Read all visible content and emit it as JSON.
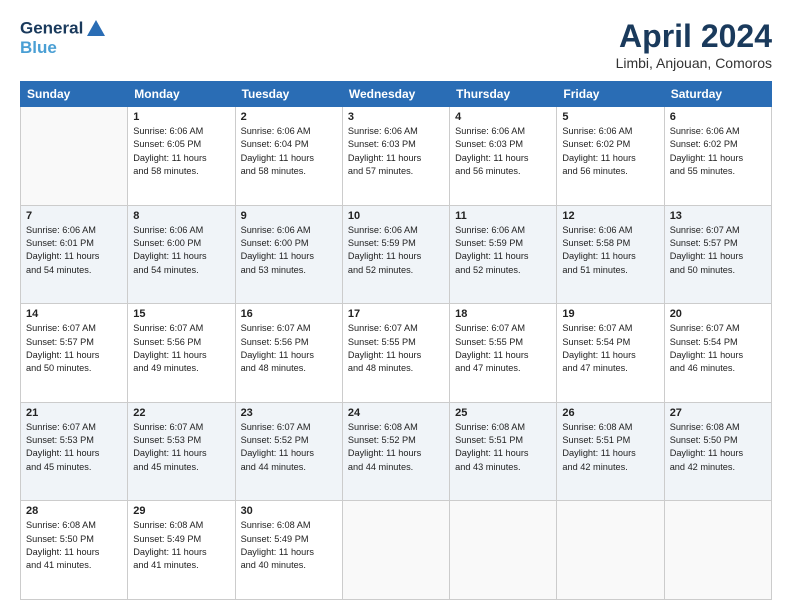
{
  "header": {
    "logo_line1": "General",
    "logo_line2": "Blue",
    "month_title": "April 2024",
    "location": "Limbi, Anjouan, Comoros"
  },
  "weekdays": [
    "Sunday",
    "Monday",
    "Tuesday",
    "Wednesday",
    "Thursday",
    "Friday",
    "Saturday"
  ],
  "weeks": [
    [
      {
        "day": "",
        "info": ""
      },
      {
        "day": "1",
        "info": "Sunrise: 6:06 AM\nSunset: 6:05 PM\nDaylight: 11 hours\nand 58 minutes."
      },
      {
        "day": "2",
        "info": "Sunrise: 6:06 AM\nSunset: 6:04 PM\nDaylight: 11 hours\nand 58 minutes."
      },
      {
        "day": "3",
        "info": "Sunrise: 6:06 AM\nSunset: 6:03 PM\nDaylight: 11 hours\nand 57 minutes."
      },
      {
        "day": "4",
        "info": "Sunrise: 6:06 AM\nSunset: 6:03 PM\nDaylight: 11 hours\nand 56 minutes."
      },
      {
        "day": "5",
        "info": "Sunrise: 6:06 AM\nSunset: 6:02 PM\nDaylight: 11 hours\nand 56 minutes."
      },
      {
        "day": "6",
        "info": "Sunrise: 6:06 AM\nSunset: 6:02 PM\nDaylight: 11 hours\nand 55 minutes."
      }
    ],
    [
      {
        "day": "7",
        "info": "Sunrise: 6:06 AM\nSunset: 6:01 PM\nDaylight: 11 hours\nand 54 minutes."
      },
      {
        "day": "8",
        "info": "Sunrise: 6:06 AM\nSunset: 6:00 PM\nDaylight: 11 hours\nand 54 minutes."
      },
      {
        "day": "9",
        "info": "Sunrise: 6:06 AM\nSunset: 6:00 PM\nDaylight: 11 hours\nand 53 minutes."
      },
      {
        "day": "10",
        "info": "Sunrise: 6:06 AM\nSunset: 5:59 PM\nDaylight: 11 hours\nand 52 minutes."
      },
      {
        "day": "11",
        "info": "Sunrise: 6:06 AM\nSunset: 5:59 PM\nDaylight: 11 hours\nand 52 minutes."
      },
      {
        "day": "12",
        "info": "Sunrise: 6:06 AM\nSunset: 5:58 PM\nDaylight: 11 hours\nand 51 minutes."
      },
      {
        "day": "13",
        "info": "Sunrise: 6:07 AM\nSunset: 5:57 PM\nDaylight: 11 hours\nand 50 minutes."
      }
    ],
    [
      {
        "day": "14",
        "info": "Sunrise: 6:07 AM\nSunset: 5:57 PM\nDaylight: 11 hours\nand 50 minutes."
      },
      {
        "day": "15",
        "info": "Sunrise: 6:07 AM\nSunset: 5:56 PM\nDaylight: 11 hours\nand 49 minutes."
      },
      {
        "day": "16",
        "info": "Sunrise: 6:07 AM\nSunset: 5:56 PM\nDaylight: 11 hours\nand 48 minutes."
      },
      {
        "day": "17",
        "info": "Sunrise: 6:07 AM\nSunset: 5:55 PM\nDaylight: 11 hours\nand 48 minutes."
      },
      {
        "day": "18",
        "info": "Sunrise: 6:07 AM\nSunset: 5:55 PM\nDaylight: 11 hours\nand 47 minutes."
      },
      {
        "day": "19",
        "info": "Sunrise: 6:07 AM\nSunset: 5:54 PM\nDaylight: 11 hours\nand 47 minutes."
      },
      {
        "day": "20",
        "info": "Sunrise: 6:07 AM\nSunset: 5:54 PM\nDaylight: 11 hours\nand 46 minutes."
      }
    ],
    [
      {
        "day": "21",
        "info": "Sunrise: 6:07 AM\nSunset: 5:53 PM\nDaylight: 11 hours\nand 45 minutes."
      },
      {
        "day": "22",
        "info": "Sunrise: 6:07 AM\nSunset: 5:53 PM\nDaylight: 11 hours\nand 45 minutes."
      },
      {
        "day": "23",
        "info": "Sunrise: 6:07 AM\nSunset: 5:52 PM\nDaylight: 11 hours\nand 44 minutes."
      },
      {
        "day": "24",
        "info": "Sunrise: 6:08 AM\nSunset: 5:52 PM\nDaylight: 11 hours\nand 44 minutes."
      },
      {
        "day": "25",
        "info": "Sunrise: 6:08 AM\nSunset: 5:51 PM\nDaylight: 11 hours\nand 43 minutes."
      },
      {
        "day": "26",
        "info": "Sunrise: 6:08 AM\nSunset: 5:51 PM\nDaylight: 11 hours\nand 42 minutes."
      },
      {
        "day": "27",
        "info": "Sunrise: 6:08 AM\nSunset: 5:50 PM\nDaylight: 11 hours\nand 42 minutes."
      }
    ],
    [
      {
        "day": "28",
        "info": "Sunrise: 6:08 AM\nSunset: 5:50 PM\nDaylight: 11 hours\nand 41 minutes."
      },
      {
        "day": "29",
        "info": "Sunrise: 6:08 AM\nSunset: 5:49 PM\nDaylight: 11 hours\nand 41 minutes."
      },
      {
        "day": "30",
        "info": "Sunrise: 6:08 AM\nSunset: 5:49 PM\nDaylight: 11 hours\nand 40 minutes."
      },
      {
        "day": "",
        "info": ""
      },
      {
        "day": "",
        "info": ""
      },
      {
        "day": "",
        "info": ""
      },
      {
        "day": "",
        "info": ""
      }
    ]
  ]
}
